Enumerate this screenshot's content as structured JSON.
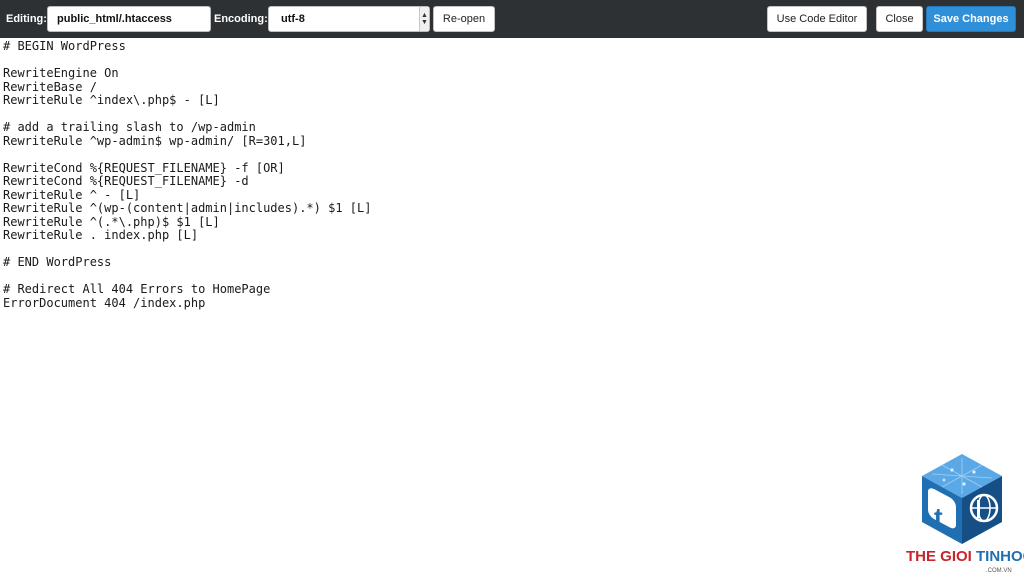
{
  "toolbar": {
    "editing_label": "Editing:",
    "filename": "public_html/.htaccess",
    "encoding_label": "Encoding:",
    "encoding_value": "utf-8",
    "reopen_label": "Re-open",
    "code_editor_label": "Use Code Editor",
    "close_label": "Close",
    "save_label": "Save Changes"
  },
  "editor": {
    "lines": [
      "# BEGIN WordPress",
      "",
      "RewriteEngine On",
      "RewriteBase /",
      "RewriteRule ^index\\.php$ - [L]",
      "",
      "# add a trailing slash to /wp-admin",
      "RewriteRule ^wp-admin$ wp-admin/ [R=301,L]",
      "",
      "RewriteCond %{REQUEST_FILENAME} -f [OR]",
      "RewriteCond %{REQUEST_FILENAME} -d",
      "RewriteRule ^ - [L]",
      "RewriteRule ^(wp-(content|admin|includes).*) $1 [L]",
      "RewriteRule ^(.*\\.php)$ $1 [L]",
      "RewriteRule . index.php [L]",
      "",
      "# END WordPress",
      "",
      "# Redirect All 404 Errors to HomePage",
      "ErrorDocument 404 /index.php"
    ]
  },
  "watermark": {
    "brand_part1": "THE GIOI ",
    "brand_part2": "TINHOC",
    "domain": ".COM.VN",
    "icon": "cube-logo-icon",
    "colors": {
      "red": "#c9252c",
      "blue": "#1f6fb2",
      "dark_blue": "#164f86"
    }
  },
  "colors": {
    "toolbar_bg": "#2e3133",
    "primary_button": "#2f8fd8"
  }
}
